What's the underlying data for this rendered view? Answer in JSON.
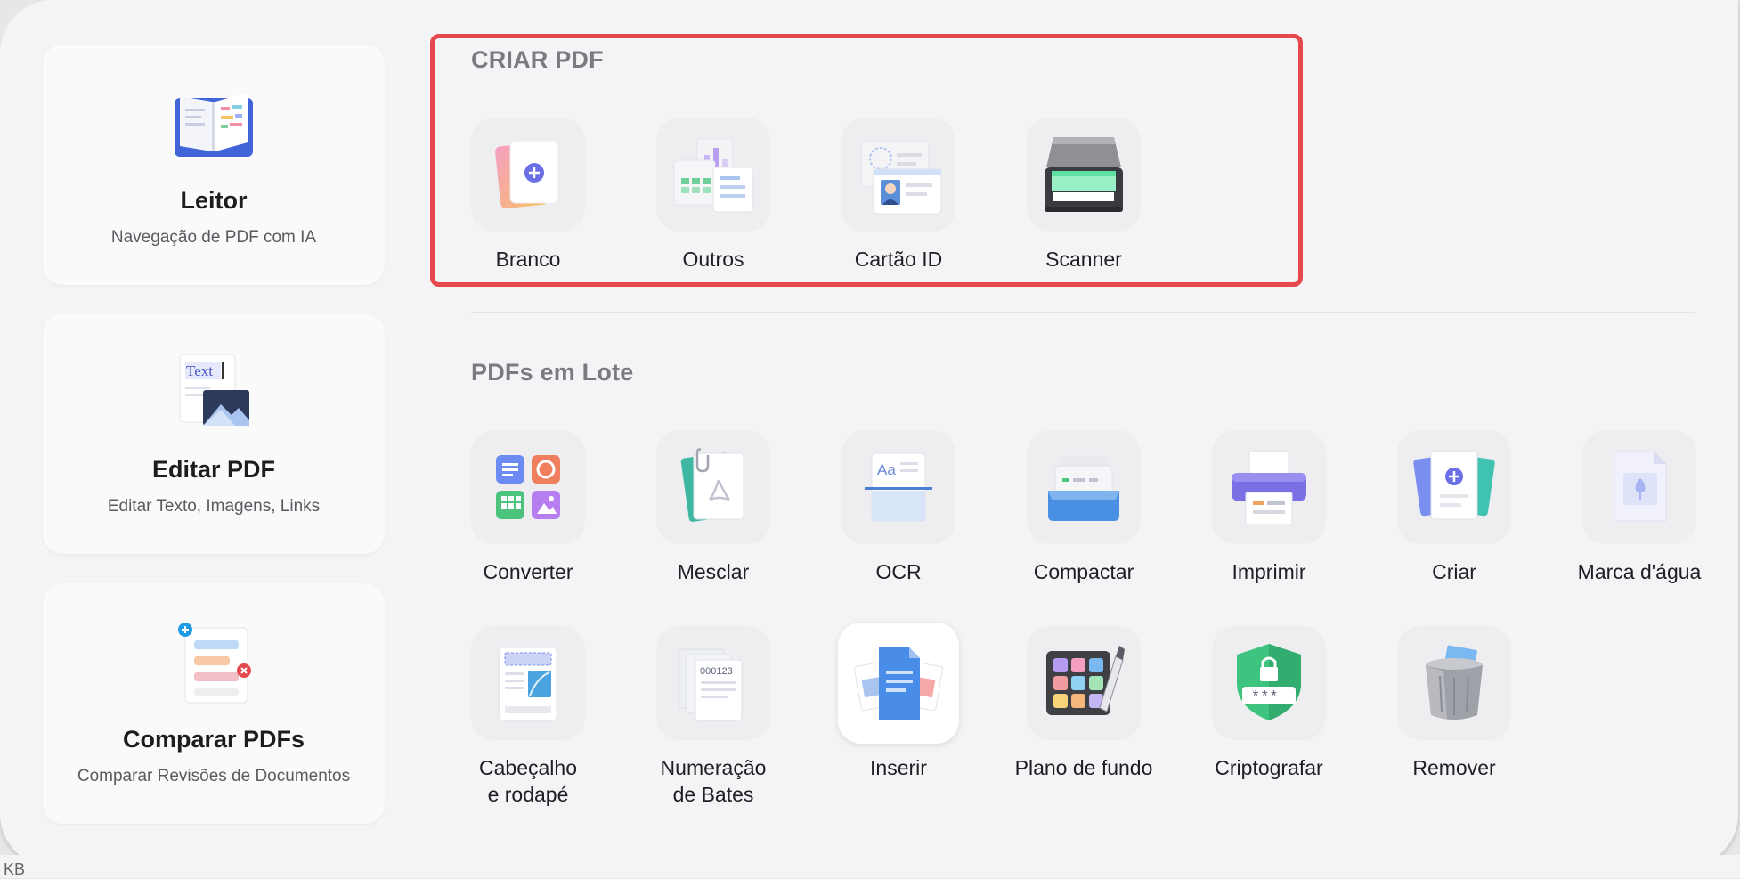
{
  "sidebar": {
    "cards": [
      {
        "title": "Leitor",
        "subtitle": "Navegação de PDF com IA",
        "icon": "book-icon"
      },
      {
        "title": "Editar PDF",
        "subtitle": "Editar Texto, Imagens, Links",
        "icon": "edit-text-icon",
        "icon_text": "Text"
      },
      {
        "title": "Comparar PDFs",
        "subtitle": "Comparar Revisões de Documentos",
        "icon": "compare-docs-icon"
      }
    ]
  },
  "create_pdf": {
    "title": "CRIAR PDF",
    "items": [
      {
        "label": "Branco",
        "icon": "blank-page-icon"
      },
      {
        "label": "Outros",
        "icon": "other-files-icon"
      },
      {
        "label": "Cartão ID",
        "icon": "id-card-icon"
      },
      {
        "label": "Scanner",
        "icon": "scanner-icon"
      }
    ]
  },
  "batch": {
    "title": "PDFs em Lote",
    "items": [
      {
        "label": "Converter",
        "icon": "convert-icon"
      },
      {
        "label": "Mesclar",
        "icon": "merge-icon"
      },
      {
        "label": "OCR",
        "icon": "ocr-icon",
        "icon_text": "Aa"
      },
      {
        "label": "Compactar",
        "icon": "compress-icon"
      },
      {
        "label": "Imprimir",
        "icon": "print-icon"
      },
      {
        "label": "Criar",
        "icon": "create-icon"
      },
      {
        "label": "Marca d'água",
        "icon": "watermark-icon"
      },
      {
        "label_line1": "Cabeçalho",
        "label_line2": "e rodapé",
        "icon": "header-footer-icon"
      },
      {
        "label_line1": "Numeração",
        "label_line2": "de Bates",
        "icon": "bates-number-icon",
        "icon_text": "000123"
      },
      {
        "label": "Inserir",
        "icon": "insert-icon"
      },
      {
        "label": "Plano de fundo",
        "icon": "background-icon"
      },
      {
        "label": "Criptografar",
        "icon": "encrypt-icon",
        "icon_text": "***"
      },
      {
        "label": "Remover",
        "icon": "trash-icon"
      }
    ]
  },
  "status": {
    "size_unit": "KB"
  },
  "colors": {
    "highlight": "#e5484d",
    "accent": "#6b6fe6",
    "background": "#f4f4f6"
  }
}
